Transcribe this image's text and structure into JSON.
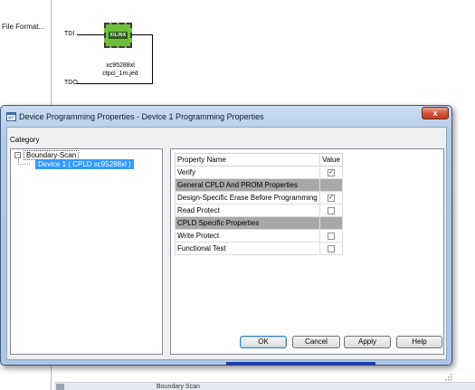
{
  "background": {
    "file_format_label": "File Format...",
    "tdi_label": "TDI",
    "tdo_label": "TDO",
    "chip_logo": "XILINX",
    "device_name": "xc95288xl",
    "device_file": "ctpci_1m.jed",
    "taskbar_text": "Boundary Scan"
  },
  "dialog": {
    "title": "Device Programming Properties - Device 1 Programming Properties",
    "close_label": "x",
    "category_label": "Category",
    "tree": {
      "root_label": "Boundary-Scan",
      "expander": "-",
      "child_label": "Device 1 ( CPLD xc95288xl )"
    },
    "properties": {
      "header": {
        "name": "Property Name",
        "value": "Value"
      },
      "rows": [
        {
          "name": "Verify",
          "checked": "✓"
        },
        {
          "name": "General CPLD And PROM Properties",
          "section": true
        },
        {
          "name": "Design-Specific Erase Before Programming",
          "checked": "✓"
        },
        {
          "name": "Read Protect",
          "checked": ""
        },
        {
          "name": "CPLD Specific Properties",
          "section": true
        },
        {
          "name": "Write Protect",
          "checked": ""
        },
        {
          "name": "Functional Test",
          "checked": ""
        }
      ]
    },
    "buttons": {
      "ok": "OK",
      "cancel": "Cancel",
      "apply": "Apply",
      "help": "Help"
    }
  },
  "colors": {
    "selection": "#3399ff",
    "section_row": "#a8a8a8",
    "chip_green": "#6fbe3c",
    "close_red": "#c23c22"
  }
}
